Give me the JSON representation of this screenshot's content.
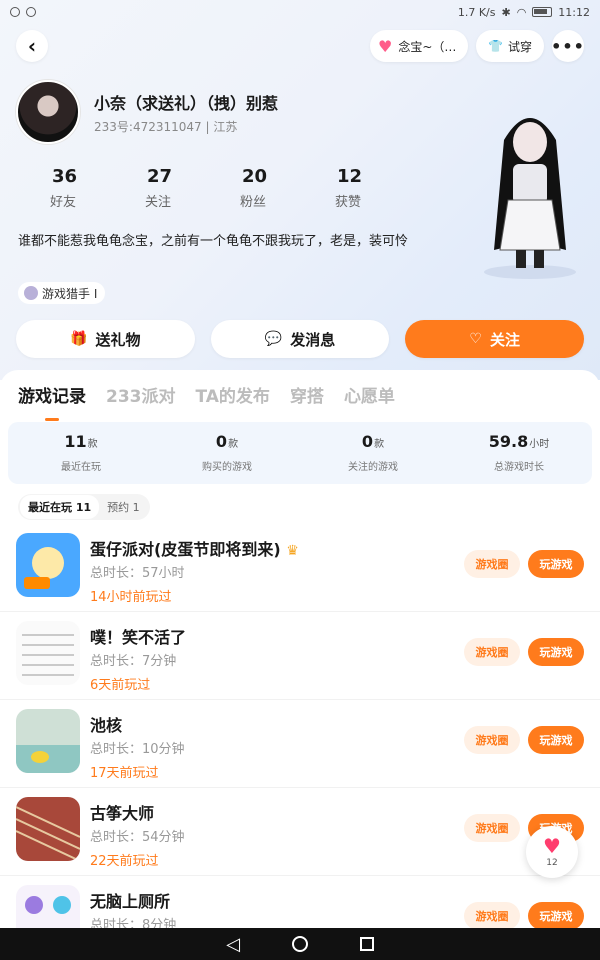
{
  "status_bar": {
    "net_speed": "1.7 K/s",
    "time": "11:12"
  },
  "top_nav": {
    "pet_label": "念宝~（…",
    "tryon_label": "试穿",
    "more_label": "•••"
  },
  "profile": {
    "name": "小奈（求送礼）（拽）别惹",
    "id_line": "233号:472311047",
    "region": "江苏",
    "stats": [
      {
        "value": "36",
        "label": "好友"
      },
      {
        "value": "27",
        "label": "关注"
      },
      {
        "value": "20",
        "label": "粉丝"
      },
      {
        "value": "12",
        "label": "获赞"
      }
    ],
    "bio": "谁都不能惹我龟龟念宝，之前有一个龟龟不跟我玩了，老是，装可怜",
    "tag": "游戏猎手 I"
  },
  "actions": {
    "gift": "送礼物",
    "message": "发消息",
    "follow": "关注"
  },
  "tabs": [
    "游戏记录",
    "233派对",
    "TA的发布",
    "穿搭",
    "心愿单"
  ],
  "summary": [
    {
      "value": "11",
      "unit": "款",
      "label": "最近在玩"
    },
    {
      "value": "0",
      "unit": "款",
      "label": "购买的游戏"
    },
    {
      "value": "0",
      "unit": "款",
      "label": "关注的游戏"
    },
    {
      "value": "59.8",
      "unit": "小时",
      "label": "总游戏时长"
    }
  ],
  "filters": {
    "recent": "最近在玩 11",
    "reserve": "预约 1"
  },
  "game_buttons": {
    "circle": "游戏圈",
    "play": "玩游戏"
  },
  "games": [
    {
      "title": "蛋仔派对(皮蛋节即将到来)",
      "duration": "总时长：57小时",
      "last": "14小时前玩过"
    },
    {
      "title": "噗！笑不活了",
      "duration": "总时长：7分钟",
      "last": "6天前玩过"
    },
    {
      "title": "池核",
      "duration": "总时长：10分钟",
      "last": "17天前玩过"
    },
    {
      "title": "古筝大师",
      "duration": "总时长：54分钟",
      "last": "22天前玩过"
    },
    {
      "title": "无脑上厕所",
      "duration": "总时长：8分钟",
      "last": ""
    }
  ],
  "float_button": {
    "count": "12"
  }
}
